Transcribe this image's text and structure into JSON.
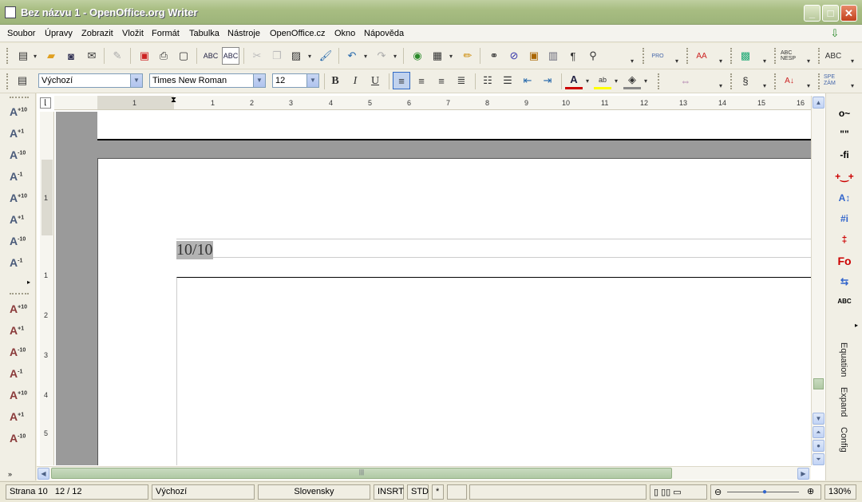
{
  "window": {
    "title": "Bez názvu 1 - OpenOffice.org Writer",
    "controls": [
      "_",
      "□",
      "✕"
    ]
  },
  "menubar": {
    "items": [
      {
        "label": "Soubor"
      },
      {
        "label": "Úpravy"
      },
      {
        "label": "Zobrazit"
      },
      {
        "label": "Vložit"
      },
      {
        "label": "Formát"
      },
      {
        "label": "Tabulka"
      },
      {
        "label": "Nástroje"
      },
      {
        "label": "OpenOffice.cz"
      },
      {
        "label": "Okno"
      },
      {
        "label": "Nápověda"
      }
    ]
  },
  "toolbar_standard": {
    "buttons": [
      "new-icon",
      "open-icon",
      "save-icon",
      "email-icon",
      "edit-file-icon",
      "export-pdf-icon",
      "print-icon",
      "print-preview-icon",
      "spellcheck-icon",
      "autospellcheck-icon",
      "cut-icon",
      "copy-icon",
      "paste-icon",
      "format-paintbrush-icon",
      "undo-icon",
      "redo-icon",
      "navigator-globe-icon",
      "table-icon",
      "draw-functions-icon",
      "find-replace-binoculars-icon",
      "navigator-icon",
      "gallery-icon",
      "data-sources-icon",
      "formatting-marks-icon",
      "zoom-icon"
    ],
    "extra": {
      "pro_label": "PRO",
      "case_label": "AA",
      "nesp_label": "ABC NESP"
    }
  },
  "toolbar_formatting": {
    "paragraph_style": "Výchozí",
    "font_name": "Times New Roman",
    "font_size": "12",
    "bold": "B",
    "italic": "I",
    "underline": "U",
    "spe_label": "SPE ZÁM"
  },
  "ruler": {
    "h_numbers": [
      "1",
      "1",
      "2",
      "3",
      "4",
      "5",
      "6",
      "7",
      "8",
      "9",
      "10",
      "11",
      "12",
      "13",
      "14",
      "15",
      "16"
    ],
    "v_numbers": [
      "1",
      "1",
      "2",
      "3",
      "4",
      "5"
    ]
  },
  "document": {
    "header_text": "10/10"
  },
  "left_panel": {
    "group1": [
      "+10",
      "+1",
      "-10",
      "-1",
      "+10",
      "+1",
      "-10",
      "-1"
    ],
    "group2": [
      "+10",
      "+1",
      "-10",
      "-1",
      "+10",
      "+1",
      "-10"
    ]
  },
  "right_panel": {
    "icons": [
      "degree-icon",
      "quote-icon",
      "ligature-icon",
      "insert-space-icon",
      "autofit-icon",
      "info-icon",
      "mark-icon",
      "fo-icon",
      "refresh-icon",
      "abc-icon"
    ],
    "labels": {
      "equation": "Equation",
      "expand": "Expand",
      "config": "Config"
    },
    "degree": "o~",
    "quote": "\"\"",
    "ligature": "-fi",
    "fo": "Fo",
    "abc": "ABC"
  },
  "statusbar": {
    "page": "Strana 10",
    "page_count": "12 / 12",
    "style": "Výchozí",
    "language": "Slovensky",
    "insert_mode": "INSRT",
    "selection_mode": "STD",
    "modified": "*",
    "zoom": "130%"
  }
}
